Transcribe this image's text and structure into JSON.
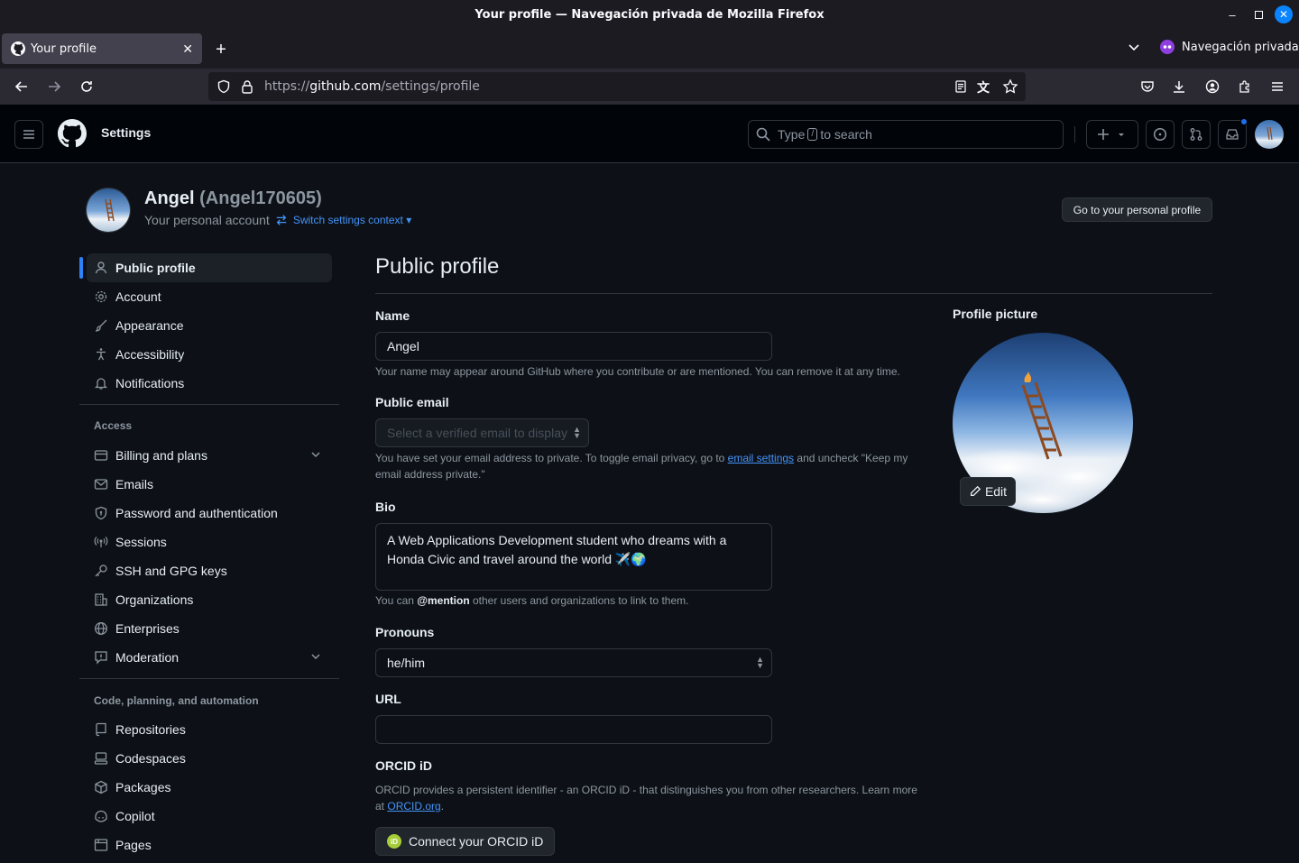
{
  "window": {
    "title": "Your profile — Navegación privada de Mozilla Firefox"
  },
  "tabs": [
    {
      "label": "Your profile"
    }
  ],
  "browser": {
    "private_label": "Navegación privada",
    "url_prefix": "https://",
    "url_host": "github.com",
    "url_path": "/settings/profile"
  },
  "header": {
    "context": "Settings",
    "search_pre": "Type",
    "search_key": "/",
    "search_post": "to search"
  },
  "account": {
    "name": "Angel",
    "login": "(Angel170605)",
    "subtitle": "Your personal account",
    "switch_label": "Switch settings context",
    "profile_button": "Go to your personal profile"
  },
  "sidebar": {
    "items": [
      {
        "label": "Public profile",
        "icon": "person-icon"
      },
      {
        "label": "Account",
        "icon": "gear-icon"
      },
      {
        "label": "Appearance",
        "icon": "paintbrush-icon"
      },
      {
        "label": "Accessibility",
        "icon": "accessibility-icon"
      },
      {
        "label": "Notifications",
        "icon": "bell-icon"
      }
    ],
    "group_access": "Access",
    "access_items": [
      {
        "label": "Billing and plans",
        "icon": "credit-card-icon"
      },
      {
        "label": "Emails",
        "icon": "mail-icon"
      },
      {
        "label": "Password and authentication",
        "icon": "shield-lock-icon"
      },
      {
        "label": "Sessions",
        "icon": "broadcast-icon"
      },
      {
        "label": "SSH and GPG keys",
        "icon": "key-icon"
      },
      {
        "label": "Organizations",
        "icon": "organization-icon"
      },
      {
        "label": "Enterprises",
        "icon": "globe-icon"
      },
      {
        "label": "Moderation",
        "icon": "report-icon"
      }
    ],
    "group_code": "Code, planning, and automation",
    "code_items": [
      {
        "label": "Repositories",
        "icon": "repo-icon"
      },
      {
        "label": "Codespaces",
        "icon": "codespaces-icon"
      },
      {
        "label": "Packages",
        "icon": "package-icon"
      },
      {
        "label": "Copilot",
        "icon": "copilot-icon"
      },
      {
        "label": "Pages",
        "icon": "browser-icon"
      }
    ]
  },
  "main": {
    "title": "Public profile",
    "name_label": "Name",
    "name_value": "Angel",
    "name_note": "Your name may appear around GitHub where you contribute or are mentioned. You can remove it at any time.",
    "email_label": "Public email",
    "email_placeholder": "Select a verified email to display",
    "email_note_pre": "You have set your email address to private. To toggle email privacy, go to",
    "email_note_link": "email settings",
    "email_note_post": "and uncheck \"Keep my email address private.\"",
    "bio_label": "Bio",
    "bio_value": "A Web Applications Development student who dreams with a Honda Civic   and travel around the world ✈️🌍",
    "bio_note_pre": "You can",
    "bio_note_mention": "@mention",
    "bio_note_post": "other users and organizations to link to them.",
    "pronouns_label": "Pronouns",
    "pronouns_value": "he/him",
    "url_label": "URL",
    "url_value": "",
    "orcid_label": "ORCID iD",
    "orcid_note_pre": "ORCID provides a persistent identifier - an ORCID iD - that distinguishes you from other researchers. Learn more at",
    "orcid_note_link": "ORCID.org",
    "orcid_button": "Connect your ORCID iD",
    "orcid_logo_text": "iD",
    "picture_label": "Profile picture",
    "edit_label": "Edit"
  }
}
